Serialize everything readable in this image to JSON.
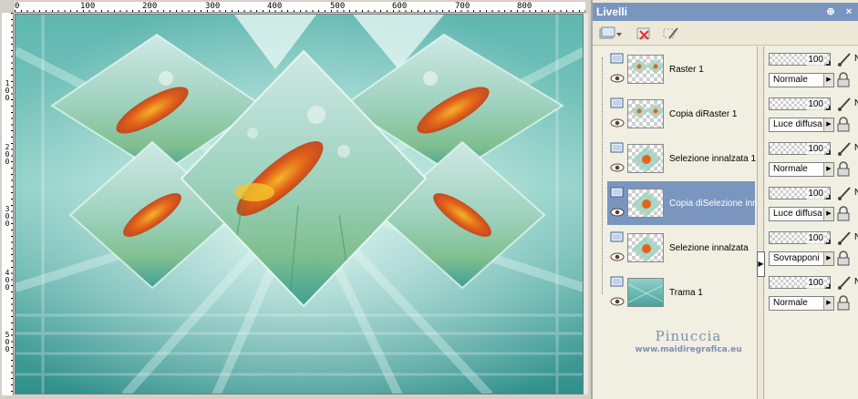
{
  "ruler": {
    "top_labels": [
      "0",
      "100",
      "200",
      "300",
      "400",
      "500",
      "600",
      "700",
      "800"
    ],
    "left_labels": [
      "1\n0\n0",
      "2\n0\n0",
      "3\n0\n0",
      "4\n0\n0",
      "5\n0\n0"
    ]
  },
  "panel": {
    "title": "Livelli",
    "pin_glyph": "⊕",
    "close_glyph": "×"
  },
  "layers": [
    {
      "name": "Raster 1",
      "opacity": "100",
      "blend": "Normale",
      "selected": false
    },
    {
      "name": "Copia diRaster 1",
      "opacity": "100",
      "blend": "Luce diffusa",
      "selected": false
    },
    {
      "name": "Selezione innalzata 1",
      "opacity": "100",
      "blend": "Normale",
      "selected": false
    },
    {
      "name": "Copia diSelezione innalz",
      "opacity": "100",
      "blend": "Luce diffusa",
      "selected": true
    },
    {
      "name": "Selezione innalzata",
      "opacity": "100",
      "blend": "Sovrapponi",
      "selected": false
    },
    {
      "name": "Trama 1",
      "opacity": "100",
      "blend": "Normale",
      "selected": false
    }
  ],
  "props_n_label": "N",
  "watermark": {
    "name": "Pinuccia",
    "url": "www.maidiregrafica.eu"
  },
  "colors": {
    "panel_title": "#7a96bf",
    "selected_row": "#7a96bf",
    "teal_dark": "#2e8e8a",
    "teal_light": "#bfe6df",
    "leaf_orange": "#e35a14"
  }
}
